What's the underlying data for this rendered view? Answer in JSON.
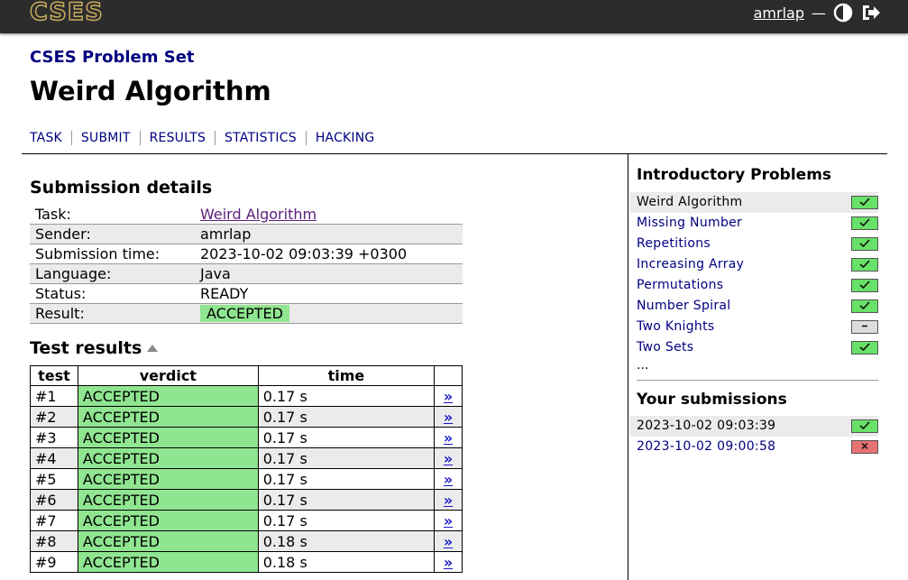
{
  "header": {
    "logo": "CSES",
    "username": "amrlap",
    "dash": "—"
  },
  "breadcrumb": "CSES Problem Set",
  "title": "Weird Algorithm",
  "nav": [
    "TASK",
    "SUBMIT",
    "RESULTS",
    "STATISTICS",
    "HACKING"
  ],
  "submission": {
    "heading": "Submission details",
    "rows": [
      {
        "label": "Task:",
        "value": "Weird Algorithm"
      },
      {
        "label": "Sender:",
        "value": "amrlap"
      },
      {
        "label": "Submission time:",
        "value": "2023-10-02 09:03:39 +0300"
      },
      {
        "label": "Language:",
        "value": "Java"
      },
      {
        "label": "Status:",
        "value": "READY"
      },
      {
        "label": "Result:",
        "value": "ACCEPTED"
      }
    ]
  },
  "tests": {
    "heading": "Test results",
    "columns": [
      "test",
      "verdict",
      "time",
      ""
    ],
    "link_glyph": "»",
    "rows": [
      {
        "test": "#1",
        "verdict": "ACCEPTED",
        "time": "0.17 s"
      },
      {
        "test": "#2",
        "verdict": "ACCEPTED",
        "time": "0.17 s"
      },
      {
        "test": "#3",
        "verdict": "ACCEPTED",
        "time": "0.17 s"
      },
      {
        "test": "#4",
        "verdict": "ACCEPTED",
        "time": "0.17 s"
      },
      {
        "test": "#5",
        "verdict": "ACCEPTED",
        "time": "0.17 s"
      },
      {
        "test": "#6",
        "verdict": "ACCEPTED",
        "time": "0.17 s"
      },
      {
        "test": "#7",
        "verdict": "ACCEPTED",
        "time": "0.17 s"
      },
      {
        "test": "#8",
        "verdict": "ACCEPTED",
        "time": "0.18 s"
      },
      {
        "test": "#9",
        "verdict": "ACCEPTED",
        "time": "0.18 s"
      }
    ]
  },
  "sidebar": {
    "heading": "Introductory Problems",
    "items": [
      {
        "label": "Weird Algorithm",
        "status": "solved",
        "current": true
      },
      {
        "label": "Missing Number",
        "status": "solved"
      },
      {
        "label": "Repetitions",
        "status": "solved"
      },
      {
        "label": "Increasing Array",
        "status": "solved"
      },
      {
        "label": "Permutations",
        "status": "solved"
      },
      {
        "label": "Number Spiral",
        "status": "solved"
      },
      {
        "label": "Two Knights",
        "status": "not-attempted"
      },
      {
        "label": "Two Sets",
        "status": "solved"
      }
    ],
    "more": "...",
    "submissions_heading": "Your submissions",
    "submissions": [
      {
        "time": "2023-10-02 09:03:39",
        "status": "accepted",
        "current": true
      },
      {
        "time": "2023-10-02 09:00:58",
        "status": "rejected"
      }
    ]
  },
  "colors": {
    "topbar": "#2c2c2c",
    "logo": "#c9ab5d",
    "link": "#000080",
    "accepted": "#90e590",
    "solved_badge": "#67e167",
    "rejected_badge": "#e87373"
  }
}
